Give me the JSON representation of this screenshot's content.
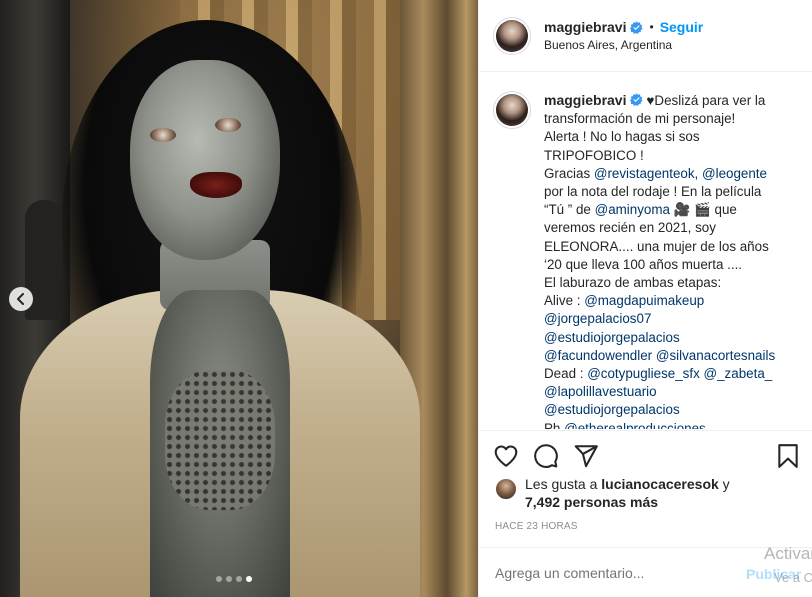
{
  "post": {
    "username": "maggiebravi",
    "follow_label": "Seguir",
    "separator": "•",
    "location": "Buenos Aires, Argentina",
    "carousel": {
      "total_slides": 4,
      "active_slide": 4
    }
  },
  "caption": {
    "username": "maggiebravi",
    "lines": [
      [
        {
          "t": "♥Deslizá para ver la"
        }
      ],
      [
        {
          "t": "transformación de mi personaje!"
        }
      ],
      [
        {
          "t": "Alerta ! No lo hagas si sos"
        }
      ],
      [
        {
          "t": "TRIPOFOBICO !"
        }
      ],
      [
        {
          "t": "Gracias "
        },
        {
          "t": "@revistagenteok",
          "m": true
        },
        {
          "t": ", "
        },
        {
          "t": "@leogente",
          "m": true
        }
      ],
      [
        {
          "t": "por la nota del rodaje ! En la película"
        }
      ],
      [
        {
          "t": "“Tú ” de "
        },
        {
          "t": "@aminyoma",
          "m": true
        },
        {
          "t": " 🎥 🎬 que"
        }
      ],
      [
        {
          "t": "veremos recién en 2021, soy"
        }
      ],
      [
        {
          "t": "ELEONORA.... una mujer de los años"
        }
      ],
      [
        {
          "t": "‘20 que lleva 100 años muerta ...."
        }
      ],
      [
        {
          "t": "El laburazo de ambas etapas:"
        }
      ],
      [
        {
          "t": "Alive : "
        },
        {
          "t": "@magdapuimakeup",
          "m": true
        }
      ],
      [
        {
          "t": "@jorgepalacios07",
          "m": true
        }
      ],
      [
        {
          "t": "@estudiojorgepalacios",
          "m": true
        }
      ],
      [
        {
          "t": "@facundowendler",
          "m": true
        },
        {
          "t": " "
        },
        {
          "t": "@silvanacortesnails",
          "m": true
        }
      ],
      [
        {
          "t": "Dead : "
        },
        {
          "t": "@cotypugliese_sfx",
          "m": true
        },
        {
          "t": " "
        },
        {
          "t": "@_zabeta_",
          "m": true
        }
      ],
      [
        {
          "t": "@lapolillavestuario",
          "m": true
        }
      ],
      [
        {
          "t": "@estudiojorgepalacios",
          "m": true
        }
      ],
      [
        {
          "t": "Ph "
        },
        {
          "t": "@etherealproducciones",
          "m": true
        }
      ]
    ]
  },
  "actions": {
    "icons": [
      "heart-icon",
      "comment-icon",
      "share-icon",
      "bookmark-icon"
    ]
  },
  "likes": {
    "prefix": "Les gusta a ",
    "user": "lucianocaceresok",
    "middle": " y",
    "count": "7,492 personas más"
  },
  "timestamp": "Hace 23 horas",
  "comment": {
    "placeholder": "Agrega un comentario...",
    "publish_label": "Publicar"
  },
  "watermark": {
    "line1": "Activar",
    "line2": "Ve a Co"
  },
  "colors": {
    "accent": "#0095f6",
    "mention": "#00376b",
    "publish_disabled": "#b2dffc",
    "verified": "#3897f0"
  }
}
